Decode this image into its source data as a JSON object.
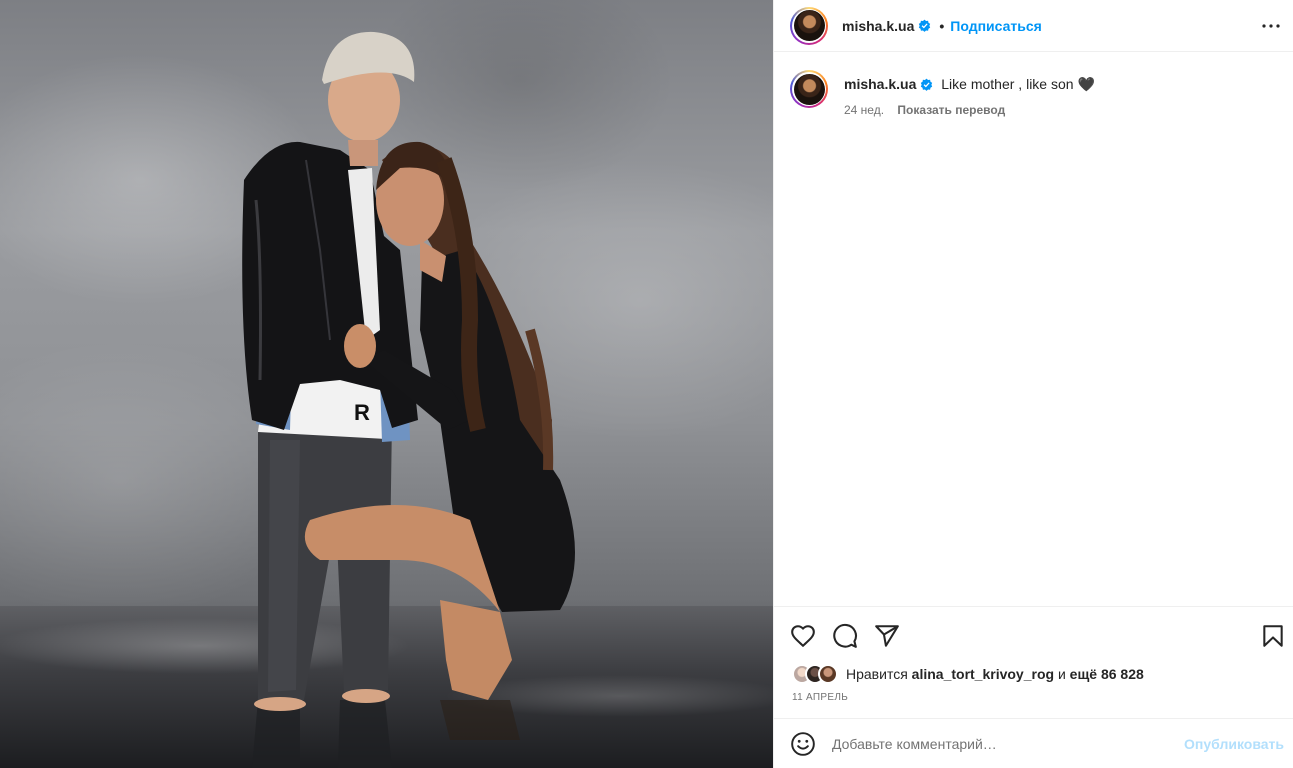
{
  "post": {
    "account": {
      "username": "misha.k.ua",
      "verified": true,
      "follow_label": "Подписаться",
      "separator": "•"
    },
    "caption": {
      "username": "misha.k.ua",
      "text": "Like mother , like son 🖤",
      "age": "24 нед.",
      "translate_label": "Показать перевод"
    },
    "likes": {
      "prefix": "Нравится",
      "user": "alina_tort_krivoy_rog",
      "joiner": "и",
      "others": "ещё 86 828"
    },
    "date": "11 АПРЕЛЬ",
    "comment": {
      "placeholder": "Добавьте комментарий…",
      "publish_label": "Опубликовать"
    },
    "photo_print_letter": "R"
  },
  "icons": {
    "more": "more-horizontal-icon",
    "like": "heart-icon",
    "comment": "comment-icon",
    "share": "send-icon",
    "save": "bookmark-icon",
    "emoji": "emoji-icon",
    "verified": "verified-badge-icon"
  },
  "colors": {
    "accent": "#0095f6",
    "publish_disabled": "#b2dffc",
    "text": "#262626",
    "muted": "#737373",
    "verified": "#0095f6"
  }
}
